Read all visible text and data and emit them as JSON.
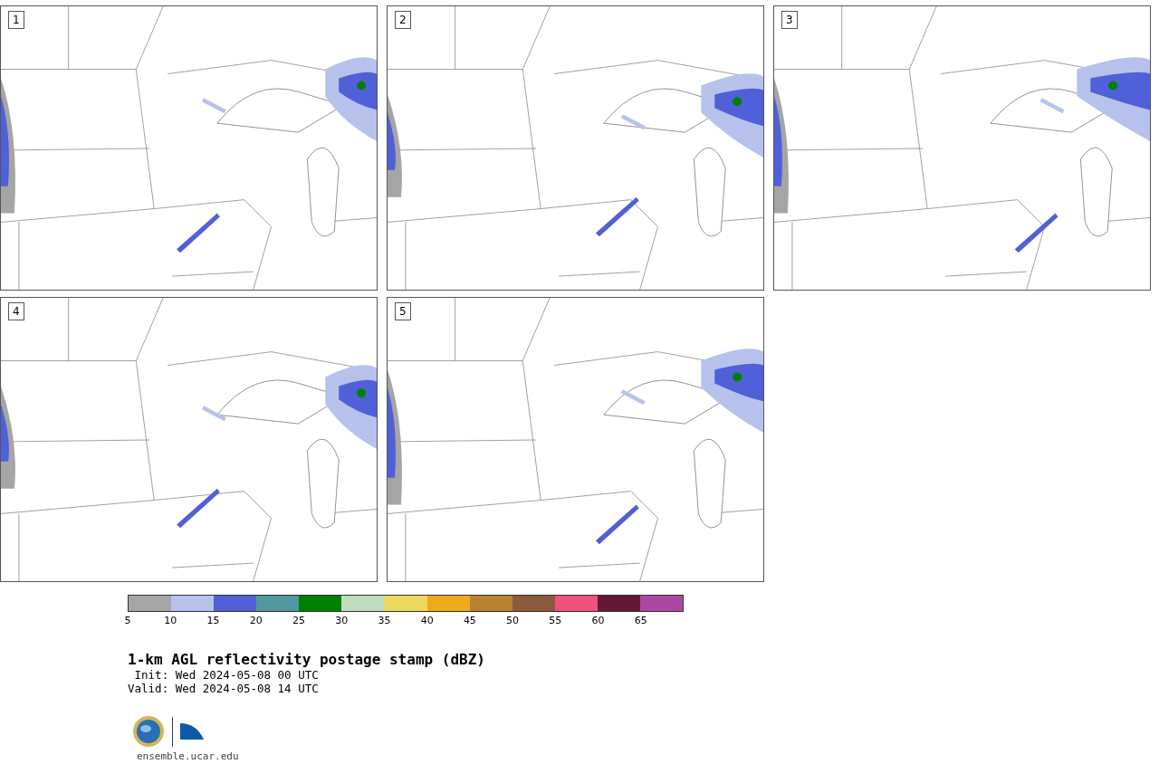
{
  "panels": [
    {
      "label": "1"
    },
    {
      "label": "2"
    },
    {
      "label": "3"
    },
    {
      "label": "4"
    },
    {
      "label": "5"
    }
  ],
  "colorbar": {
    "bins": [
      {
        "label": "5",
        "color": "#a5a5a5"
      },
      {
        "label": "10",
        "color": "#b7c2ec"
      },
      {
        "label": "15",
        "color": "#5060d8"
      },
      {
        "label": "20",
        "color": "#50979e"
      },
      {
        "label": "25",
        "color": "#008000"
      },
      {
        "label": "30",
        "color": "#bfdcbf"
      },
      {
        "label": "35",
        "color": "#eed85e"
      },
      {
        "label": "40",
        "color": "#eeaa18"
      },
      {
        "label": "45",
        "color": "#b88232"
      },
      {
        "label": "50",
        "color": "#8b5a3e"
      },
      {
        "label": "55",
        "color": "#f4507c"
      },
      {
        "label": "60",
        "color": "#641836"
      },
      {
        "label": "65",
        "color": "#ac48a4"
      }
    ]
  },
  "title": "1-km AGL reflectivity postage stamp (dBZ)",
  "init": " Init: Wed 2024-05-08 00 UTC",
  "valid": "Valid: Wed 2024-05-08 14 UTC",
  "footer": "ensemble.ucar.edu"
}
